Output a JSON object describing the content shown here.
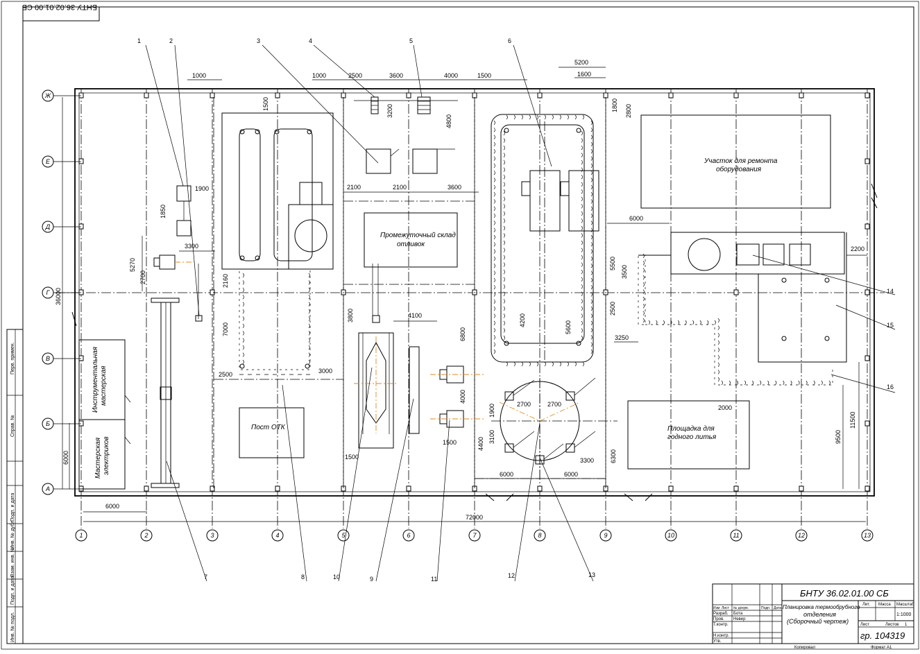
{
  "stamp_rotated": "БНТУ 36.02.01.00 СБ",
  "title_block": {
    "code": "БНТУ 36.02.01.00 СБ",
    "name_line1": "Планировка термообрубного",
    "name_line2": "отделения",
    "name_line3": "(Сборочный чертеж)",
    "group": "гр. 104319",
    "scale": "1:1000",
    "sheet_label": "Лист",
    "sheets_label": "Листов",
    "sheets_value": "1",
    "lit": "Лит.",
    "mass": "Масса",
    "scale_label": "Масштаб",
    "rows": [
      "Изм",
      "Лист",
      "№ докум.",
      "Подп.",
      "Дата"
    ],
    "developer_label": "Разраб.",
    "developer": "Бота",
    "checker_label": "Пров.",
    "checker": "Невер",
    "tcontrol": "Т.контр.",
    "ncontrol": "Н.контр.",
    "approved": "Утв.",
    "copied": "Копировал",
    "format": "Формат  А1"
  },
  "side_strip": [
    "Перв. примен.",
    "Справ. №",
    "Подп. и дата",
    "Инв. № дубл.",
    "Взам. инв. №",
    "Подп. и дата",
    "Инв. № подл."
  ],
  "rooms": {
    "repair": "Участок для ремонта оборудования",
    "repair_line1": "Участок для ремонта",
    "repair_line2": "оборудования",
    "storage_line1": "Промежуточный склад",
    "storage_line2": "отливок",
    "otk": "Пост ОТК",
    "pouring_line1": "Площадка для",
    "pouring_line2": "годного литья",
    "tool_line1": "Инструментальная",
    "tool_line2": "мастерская",
    "electric_line1": "Мастерская",
    "electric_line2": "электриков"
  },
  "column_axes": [
    "1",
    "2",
    "3",
    "4",
    "5",
    "6",
    "7",
    "8",
    "9",
    "10",
    "11",
    "12",
    "13"
  ],
  "row_axes": [
    "Ж",
    "Е",
    "Д",
    "Г",
    "В",
    "Б",
    "А"
  ],
  "callouts": [
    "1",
    "2",
    "3",
    "4",
    "5",
    "6",
    "7",
    "8",
    "9",
    "10",
    "11",
    "12",
    "13",
    "14",
    "15",
    "16"
  ],
  "dims": {
    "total_length": "72000",
    "total_width": "36000",
    "bay": "6000",
    "d1000a": "1000",
    "d1000b": "1000",
    "d2500": "2500",
    "d3600": "3600",
    "d4000": "4000",
    "d1500": "1500",
    "d5200": "5200",
    "d1600": "1600",
    "d1500v": "1500",
    "d3200": "3200",
    "d4800": "4800",
    "d1800": "1800",
    "d2800": "2800",
    "d1900": "1900",
    "d1850": "1850",
    "d3300": "3300",
    "d5270": "5270",
    "d2700": "2700",
    "d2100a": "2100",
    "d2100b": "2100",
    "d3600b": "3600",
    "d2160": "2160",
    "d7000": "7000",
    "d2500b": "2500",
    "d3000": "3000",
    "d3800": "3800",
    "d4100": "4100",
    "d6800": "6800",
    "d4000b": "4000",
    "d1500b": "1500",
    "d1500c": "1500",
    "d4200": "4200",
    "d5600": "5600",
    "d2700a": "2700",
    "d2700b": "2700",
    "d1900b": "1900",
    "d3100": "3100",
    "d4400": "4400",
    "d6000a": "6000",
    "d6000b": "6000",
    "d3300b": "3300",
    "d6300": "6300",
    "d6000c": "6000",
    "d5500": "5500",
    "d3500": "3500",
    "d2500c": "2500",
    "d3250": "3250",
    "d2200": "2200",
    "d2000": "2000",
    "d9500": "9500",
    "d11500": "11500",
    "d6000v": "6000"
  }
}
